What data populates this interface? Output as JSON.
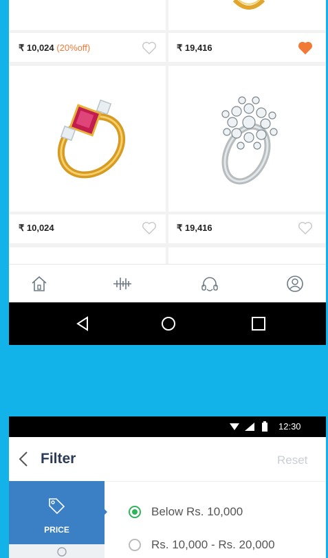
{
  "products": [
    {
      "price": "₹ 10,024",
      "discount": "(20%off)",
      "favorited": false,
      "image": "ring-icon"
    },
    {
      "price": "₹ 19,416",
      "discount": "",
      "favorited": true,
      "image": "ring-icon"
    },
    {
      "price": "₹ 10,024",
      "discount": "",
      "favorited": false,
      "image": "ruby-ring-icon"
    },
    {
      "price": "₹ 19,416",
      "discount": "",
      "favorited": false,
      "image": "diamond-cluster-ring-icon"
    }
  ],
  "bottom_nav": [
    "home-icon",
    "equalizer-icon",
    "headset-icon",
    "profile-icon"
  ],
  "system_nav": [
    "back-icon",
    "home-circle-icon",
    "recents-icon"
  ],
  "status_bar": {
    "time": "12:30"
  },
  "filter": {
    "title": "Filter",
    "reset": "Reset",
    "active_tab": "PRICE",
    "options": [
      {
        "label": "Below Rs. 10,000",
        "selected": true
      },
      {
        "label": "Rs. 10,000 - Rs. 20,000",
        "selected": false
      }
    ]
  },
  "colors": {
    "accent_orange": "#f07a36",
    "primary_blue": "#3b80c4",
    "background_cyan": "#12b3e8",
    "radio_green": "#2fb45a"
  }
}
